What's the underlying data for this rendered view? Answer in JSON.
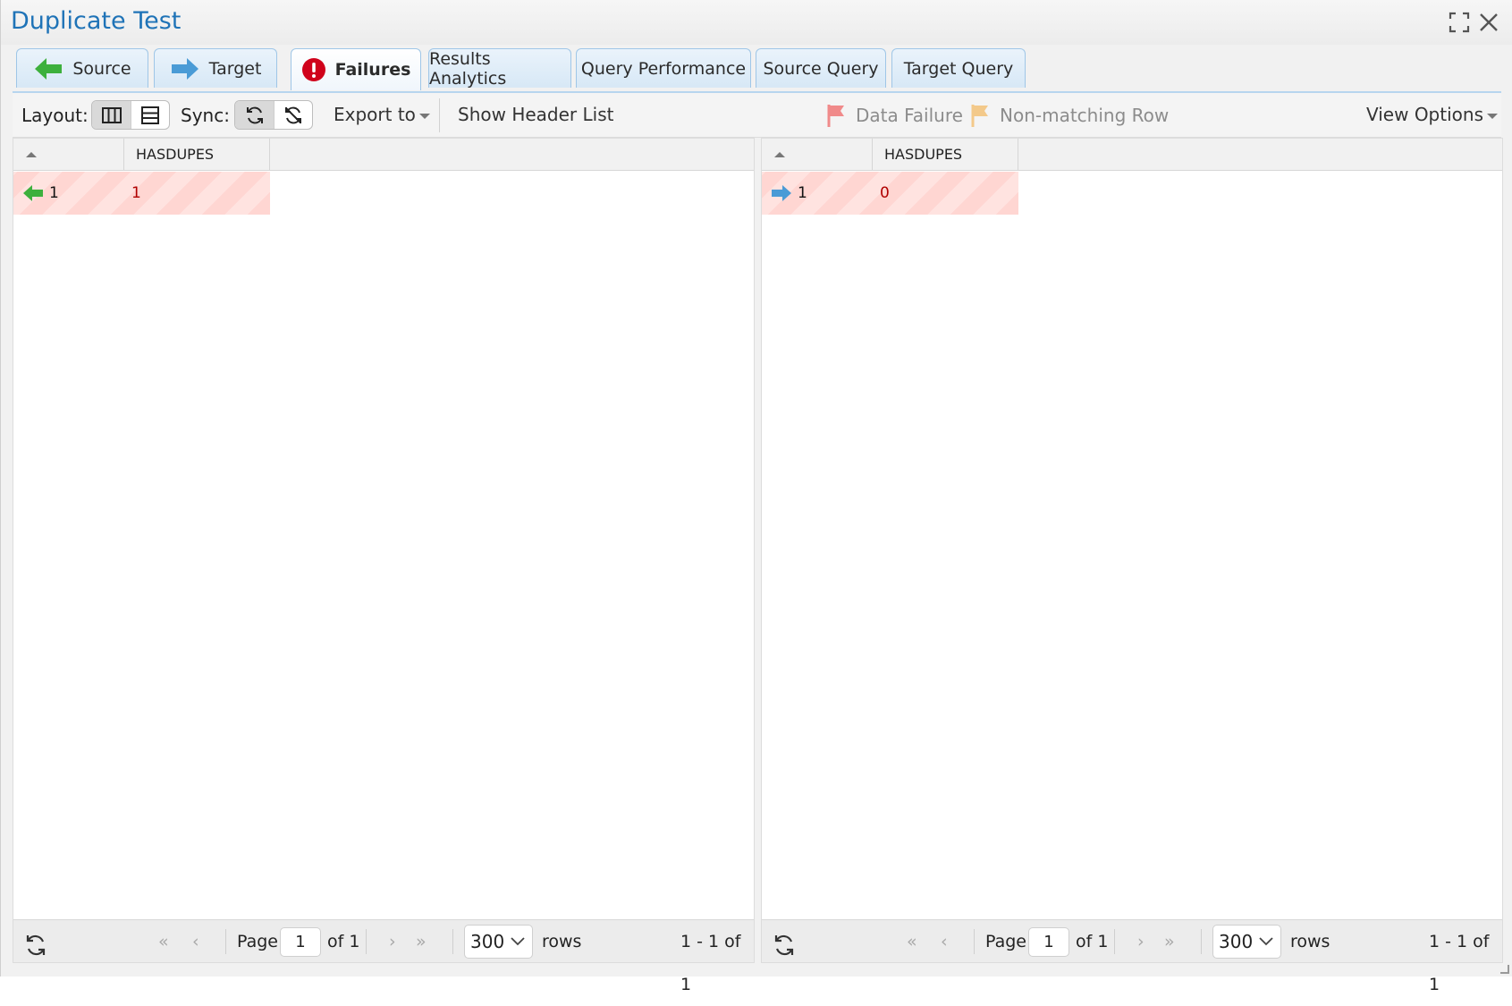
{
  "window": {
    "title": "Duplicate Test"
  },
  "tabs": [
    {
      "label": "Source",
      "icon": "arrow-left-green-icon"
    },
    {
      "label": "Target",
      "icon": "arrow-right-blue-icon"
    },
    {
      "label": "Failures",
      "icon": "error-exclamation-icon",
      "active": true
    },
    {
      "label": "Results Analytics"
    },
    {
      "label": "Query Performance"
    },
    {
      "label": "Source Query"
    },
    {
      "label": "Target Query"
    }
  ],
  "toolbar": {
    "layout_label": "Layout:",
    "sync_label": "Sync:",
    "export_label": "Export to",
    "show_header_label": "Show Header List",
    "legend_data_failure": "Data Failure",
    "legend_nonmatching": "Non-matching Row",
    "view_options_label": "View Options"
  },
  "source_grid": {
    "column_header": "HASDUPES",
    "row_index": "1",
    "row_value": "1",
    "pager": {
      "page_label": "Page",
      "page": "1",
      "of_label": "of 1",
      "rows_per_page": "300",
      "rows_label": "rows",
      "summary": "1 - 1 of 1"
    }
  },
  "target_grid": {
    "column_header": "HASDUPES",
    "row_index": "1",
    "row_value": "0",
    "pager": {
      "page_label": "Page",
      "page": "1",
      "of_label": "of 1",
      "rows_per_page": "300",
      "rows_label": "rows",
      "summary": "1 - 1 of 1"
    }
  },
  "colors": {
    "title": "#1f73b7",
    "source_arrow": "#3db03d",
    "target_arrow": "#4a9bd6",
    "error": "#d0021b",
    "failure_flag": "#f08a8a",
    "nonmatching_flag": "#f3c98a"
  }
}
